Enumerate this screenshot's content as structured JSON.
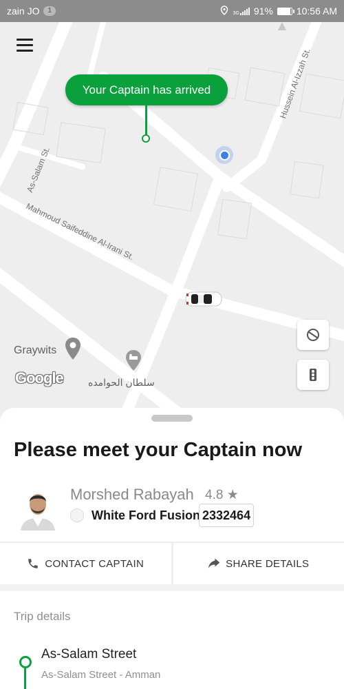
{
  "status_bar": {
    "carrier": "zain JO",
    "sim_badge": "1",
    "network": "3G",
    "battery_percent": "91%",
    "battery_level": 0.91,
    "time": "10:56 AM"
  },
  "map": {
    "menu_icon": "hamburger-menu-icon",
    "arrival_message": "Your Captain has arrived",
    "streets": {
      "as_salam": "As-Salam St.",
      "mahmoud": "Mahmoud Saifeddine Al-Irani St.",
      "hussein": "Hussein Al-Izzah St."
    },
    "poi_graywits": "Graywits",
    "poi_arabic": "سلطان الحوامده",
    "google_logo": "Google",
    "compass_icon": "compass-icon",
    "traffic_icon": "traffic-light-icon",
    "colors": {
      "accent": "#0aa03b",
      "user_location": "#3d7fe6"
    }
  },
  "sheet": {
    "title": "Please meet your Captain now",
    "captain": {
      "name": "Morshed Rabayah",
      "rating": "4.8",
      "rating_icon": "star-icon",
      "car_model": "White Ford Fusion",
      "plate": "2332464"
    },
    "actions": {
      "contact": "CONTACT CAPTAIN",
      "share": "SHARE DETAILS"
    },
    "trip": {
      "section_title": "Trip details",
      "pickup_name": "As-Salam Street",
      "pickup_address": "As-Salam Street - Amman"
    }
  }
}
